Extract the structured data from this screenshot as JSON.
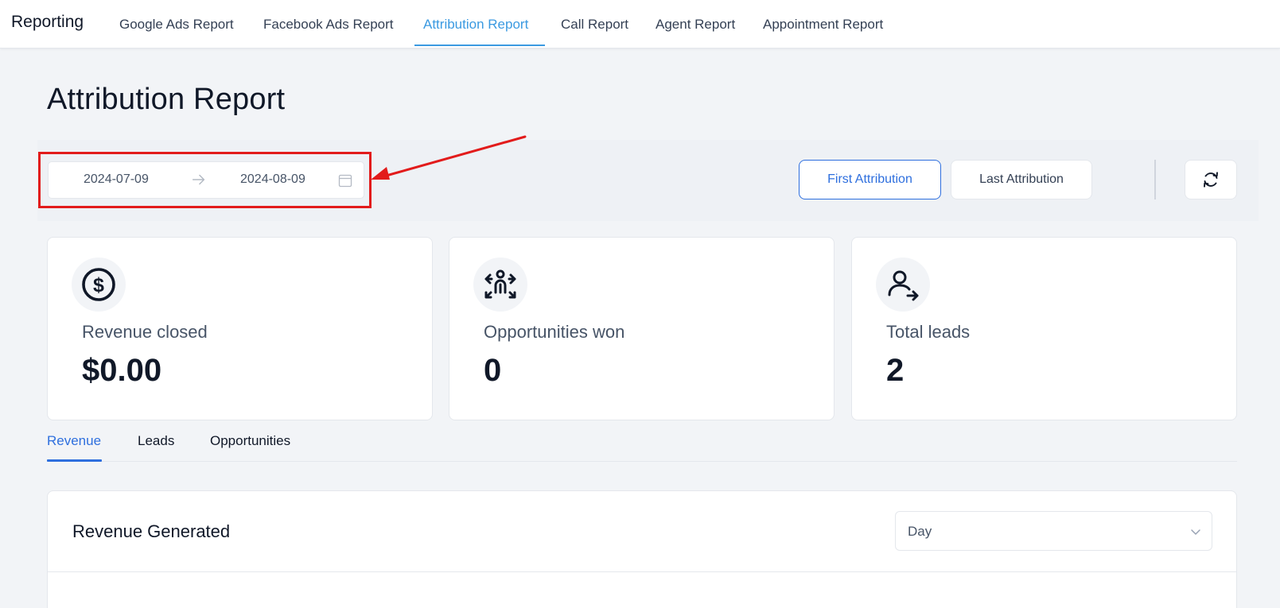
{
  "nav": {
    "brand": "Reporting",
    "tabs": [
      {
        "label": "Google Ads Report"
      },
      {
        "label": "Facebook Ads Report"
      },
      {
        "label": "Attribution Report"
      },
      {
        "label": "Call Report"
      },
      {
        "label": "Agent Report"
      },
      {
        "label": "Appointment Report"
      }
    ],
    "active_tab": "Attribution Report"
  },
  "page": {
    "title": "Attribution Report"
  },
  "filters": {
    "date_start": "2024-07-09",
    "date_end": "2024-08-09",
    "attribution_first": "First Attribution",
    "attribution_last": "Last Attribution",
    "selected_attribution": "First Attribution"
  },
  "cards": [
    {
      "icon": "dollar-circle-icon",
      "label": "Revenue closed",
      "value": "$0.00"
    },
    {
      "icon": "people-arrows-icon",
      "label": "Opportunities won",
      "value": "0"
    },
    {
      "icon": "user-arrow-icon",
      "label": "Total leads",
      "value": "2"
    }
  ],
  "subtabs": [
    {
      "label": "Revenue"
    },
    {
      "label": "Leads"
    },
    {
      "label": "Opportunities"
    }
  ],
  "active_subtab": "Revenue",
  "panel": {
    "title": "Revenue Generated",
    "interval_value": "Day"
  },
  "colors": {
    "accent": "#2e6fde",
    "nav_active": "#3b9ae1",
    "annotation": "#e21b1b"
  }
}
